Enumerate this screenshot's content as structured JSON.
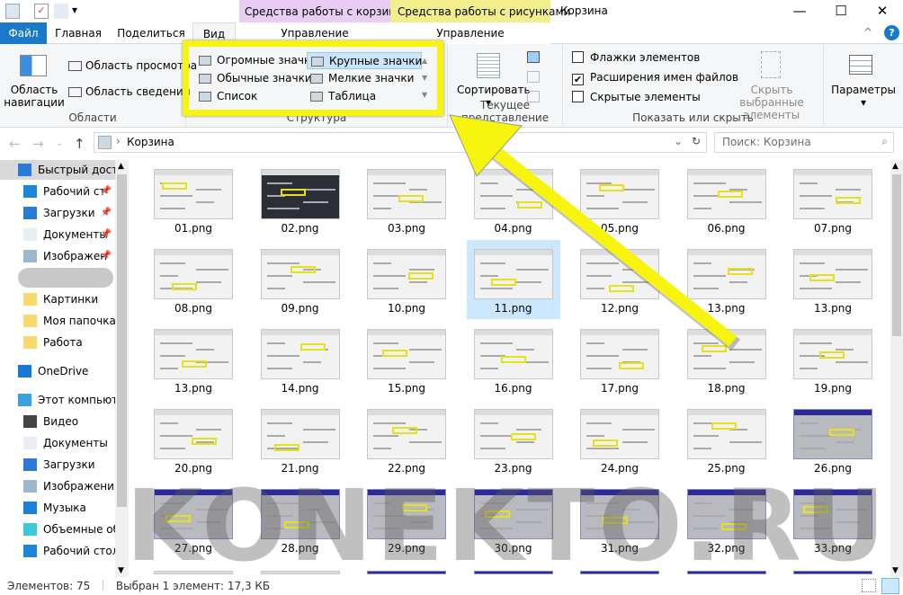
{
  "window": {
    "title": "Корзина",
    "minimize": "—",
    "maximize": "☐",
    "close": "✕",
    "help": "?",
    "collapse": "^"
  },
  "context_tabs": {
    "recycle": "Средства работы с корзиной",
    "pictures": "Средства работы с рисунками"
  },
  "tabs": {
    "file": "Файл",
    "home": "Главная",
    "share": "Поделиться",
    "view": "Вид",
    "manage1": "Управление",
    "manage2": "Управление"
  },
  "ribbon": {
    "panes": {
      "nav_pane": "Область навигации",
      "preview": "Область просмотра",
      "details": "Область сведений",
      "label": "Области"
    },
    "layout": {
      "items": [
        "Огромные значки",
        "Крупные значки",
        "Обычные значки",
        "Мелкие значки",
        "Список",
        "Таблица"
      ],
      "selected": "Крупные значки",
      "label": "Структура"
    },
    "current_view": {
      "sort": "Сортировать",
      "label": "Текущее представление"
    },
    "show_hide": {
      "item_checkboxes": "Флажки элементов",
      "item_checkboxes_checked": false,
      "extensions": "Расширения имен файлов",
      "extensions_checked": true,
      "hidden": "Скрытые элементы",
      "hidden_checked": false,
      "hide_selected": "Скрыть выбранные элементы",
      "label": "Показать или скрыть"
    },
    "options": "Параметры"
  },
  "address": {
    "path": "Корзина",
    "search_placeholder": "Поиск: Корзина"
  },
  "sidebar": [
    {
      "label": "Быстрый доступ",
      "icon": "star-icon",
      "level": 0,
      "selected": true
    },
    {
      "label": "Рабочий ст",
      "icon": "desktop-icon",
      "level": 1,
      "pinned": true
    },
    {
      "label": "Загрузки",
      "icon": "download-icon",
      "level": 1,
      "pinned": true
    },
    {
      "label": "Документы",
      "icon": "document-icon",
      "level": 1,
      "pinned": true
    },
    {
      "label": "Изображен",
      "icon": "pictures-icon",
      "level": 1,
      "pinned": true
    },
    {
      "label": "",
      "icon": "",
      "level": 1,
      "redacted": true
    },
    {
      "label": "Картинки",
      "icon": "folder-icon",
      "level": 1
    },
    {
      "label": "Моя папочка",
      "icon": "folder-icon",
      "level": 1
    },
    {
      "label": "Работа",
      "icon": "folder-icon",
      "level": 1
    },
    {
      "label": "OneDrive",
      "icon": "cloud-icon",
      "level": 0
    },
    {
      "label": "Этот компьютер",
      "icon": "computer-icon",
      "level": 0
    },
    {
      "label": "Видео",
      "icon": "video-icon",
      "level": 1
    },
    {
      "label": "Документы",
      "icon": "document-icon",
      "level": 1
    },
    {
      "label": "Загрузки",
      "icon": "download-icon",
      "level": 1
    },
    {
      "label": "Изображения",
      "icon": "pictures-icon",
      "level": 1
    },
    {
      "label": "Музыка",
      "icon": "music-icon",
      "level": 1
    },
    {
      "label": "Объемные об",
      "icon": "3d-objects-icon",
      "level": 1
    },
    {
      "label": "Рабочий стол",
      "icon": "desktop-icon",
      "level": 1
    }
  ],
  "files": [
    "01.png",
    "02.png",
    "03.png",
    "04.png",
    "05.png",
    "06.png",
    "07.png",
    "08.png",
    "09.png",
    "10.png",
    "11.png",
    "12.png",
    "13.png",
    "13.png",
    "13.png",
    "14.png",
    "15.png",
    "16.png",
    "17.png",
    "18.png",
    "19.png",
    "20.png",
    "21.png",
    "22.png",
    "23.png",
    "24.png",
    "25.png",
    "26.png",
    "27.png",
    "28.png",
    "29.png",
    "30.png",
    "31.png",
    "32.png",
    "33.png",
    "",
    "",
    "",
    "",
    "",
    "",
    ""
  ],
  "selected_file": "11.png",
  "status": {
    "count": "Элементов: 75",
    "selection": "Выбран 1 элемент: 17,3 КБ"
  },
  "watermark": "KONEKTO.RU",
  "colors": {
    "accent": "#1979ca",
    "highlight": "#f7f50d",
    "selection": "#cce8ff"
  }
}
